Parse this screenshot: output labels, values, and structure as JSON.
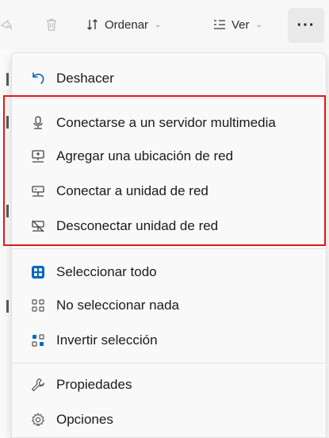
{
  "toolbar": {
    "sort_label": "Ordenar",
    "view_label": "Ver",
    "more_label": "···"
  },
  "menu": {
    "items": [
      {
        "label": "Deshacer",
        "icon": "undo-icon"
      },
      {
        "label": "Conectarse a un servidor multimedia",
        "icon": "media-server-icon"
      },
      {
        "label": "Agregar una ubicación de red",
        "icon": "add-network-location-icon"
      },
      {
        "label": "Conectar a unidad de red",
        "icon": "map-network-drive-icon"
      },
      {
        "label": "Desconectar unidad de red",
        "icon": "disconnect-network-drive-icon"
      },
      {
        "label": "Seleccionar todo",
        "icon": "select-all-icon"
      },
      {
        "label": "No seleccionar nada",
        "icon": "select-none-icon"
      },
      {
        "label": "Invertir selección",
        "icon": "invert-selection-icon"
      },
      {
        "label": "Propiedades",
        "icon": "properties-icon"
      },
      {
        "label": "Opciones",
        "icon": "options-icon"
      }
    ]
  },
  "colors": {
    "highlight": "#e0191b",
    "accent": "#0067c0"
  }
}
